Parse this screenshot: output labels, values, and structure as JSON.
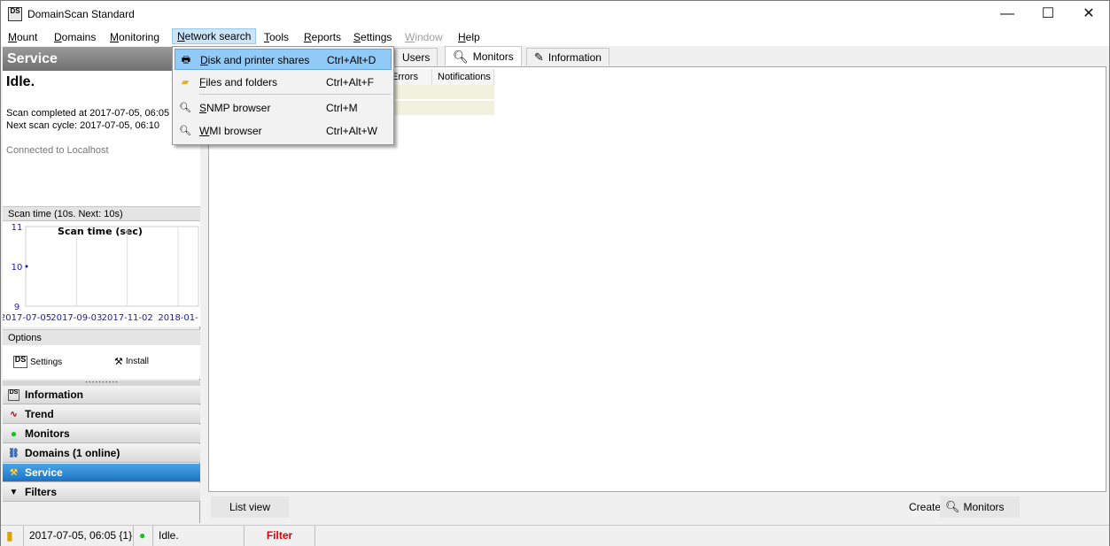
{
  "window": {
    "title": "DomainScan Standard",
    "app_icon": "DS",
    "controls": {
      "minimize": "—",
      "maximize": "☐",
      "close": "✕"
    }
  },
  "menubar": [
    {
      "label": "Mount"
    },
    {
      "label": "Domains"
    },
    {
      "label": "Monitoring"
    },
    {
      "label": "Network search"
    },
    {
      "label": "Tools"
    },
    {
      "label": "Reports"
    },
    {
      "label": "Settings"
    },
    {
      "label": "Window"
    },
    {
      "label": "Help"
    }
  ],
  "dropdown": {
    "items": [
      {
        "label": "Disk and printer shares",
        "shortcut": "Ctrl+Alt+D",
        "icon": "printer-icon"
      },
      {
        "label": "Files and folders",
        "shortcut": "Ctrl+Alt+F",
        "icon": "folder-icon"
      },
      {
        "label": "SNMP browser",
        "shortcut": "Ctrl+M",
        "icon": "magnifier-icon"
      },
      {
        "label": "WMI browser",
        "shortcut": "Ctrl+Alt+W",
        "icon": "magnifier-icon"
      }
    ]
  },
  "service": {
    "header": "Service",
    "status": "Idle.",
    "scan_completed": "Scan completed at 2017-07-05, 06:05",
    "next_scan": "Next scan cycle: 2017-07-05, 06:10",
    "connected": "Connected to Localhost",
    "scan_time_header": "Scan time (10s. Next: 10s)"
  },
  "chart_data": {
    "type": "line",
    "title": "Scan time (sec)",
    "x_ticks": [
      "2017-07-05",
      "2017-09-03",
      "2017-11-02",
      "2018-01-"
    ],
    "y_ticks": [
      11,
      10,
      9
    ],
    "ylim": [
      9,
      11
    ],
    "x": [
      "2017-07-05"
    ],
    "values": [
      10
    ],
    "grid": true
  },
  "options": {
    "header": "Options",
    "settings": "Settings",
    "install": "Install"
  },
  "nav": [
    {
      "label": "Information",
      "icon": "info-icon"
    },
    {
      "label": "Trend",
      "icon": "trend-icon"
    },
    {
      "label": "Monitors",
      "icon": "green-dot-icon"
    },
    {
      "label": "Domains (1 online)",
      "icon": "domains-icon"
    },
    {
      "label": "Service",
      "icon": "service-icon"
    },
    {
      "label": "Filters",
      "icon": "filter-icon"
    }
  ],
  "tabs": {
    "users": "Users",
    "monitors": "Monitors",
    "information": "Information"
  },
  "table": {
    "headers": [
      "Errors",
      "Notifications"
    ]
  },
  "footer": {
    "list_view": "List view",
    "create_label": "Create:",
    "create_monitors": "Monitors"
  },
  "statusbar": {
    "timestamp": "2017-07-05, 06:05 {1}",
    "status": "Idle.",
    "filter": "Filter",
    "filter_color": "#e00000"
  },
  "colors": {
    "accent": "#1b74c3",
    "menu_highlight": "#91c9f7"
  }
}
